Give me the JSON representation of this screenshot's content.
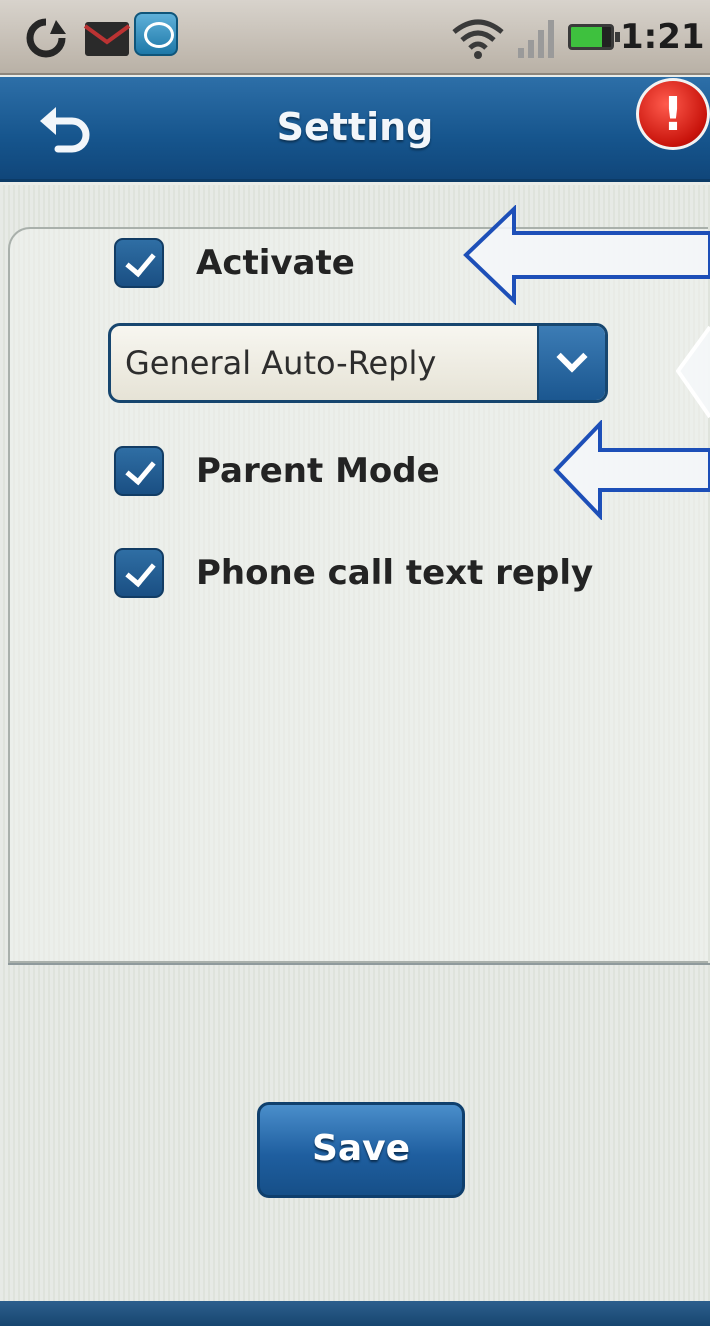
{
  "status_bar": {
    "time": "1:21",
    "icons": [
      "sync-icon",
      "mail-icon",
      "app-icon",
      "wifi-icon",
      "signal-icon",
      "battery-icon"
    ]
  },
  "title_bar": {
    "title": "Setting",
    "back_icon": "back-arrow-icon",
    "alert_icon": "alert-icon",
    "alert_glyph": "!"
  },
  "settings": {
    "activate": {
      "label": "Activate",
      "checked": true
    },
    "reply_mode": {
      "selected": "General Auto-Reply"
    },
    "parent_mode": {
      "label": "Parent Mode",
      "checked": true
    },
    "phone_call_reply": {
      "label": "Phone call text reply",
      "checked": true
    }
  },
  "save_button": {
    "label": "Save"
  },
  "colors": {
    "accent": "#1a4f83",
    "title_bar": "#16558d",
    "annotation_arrow": "#1d4fb8",
    "alert": "#c8130b"
  }
}
